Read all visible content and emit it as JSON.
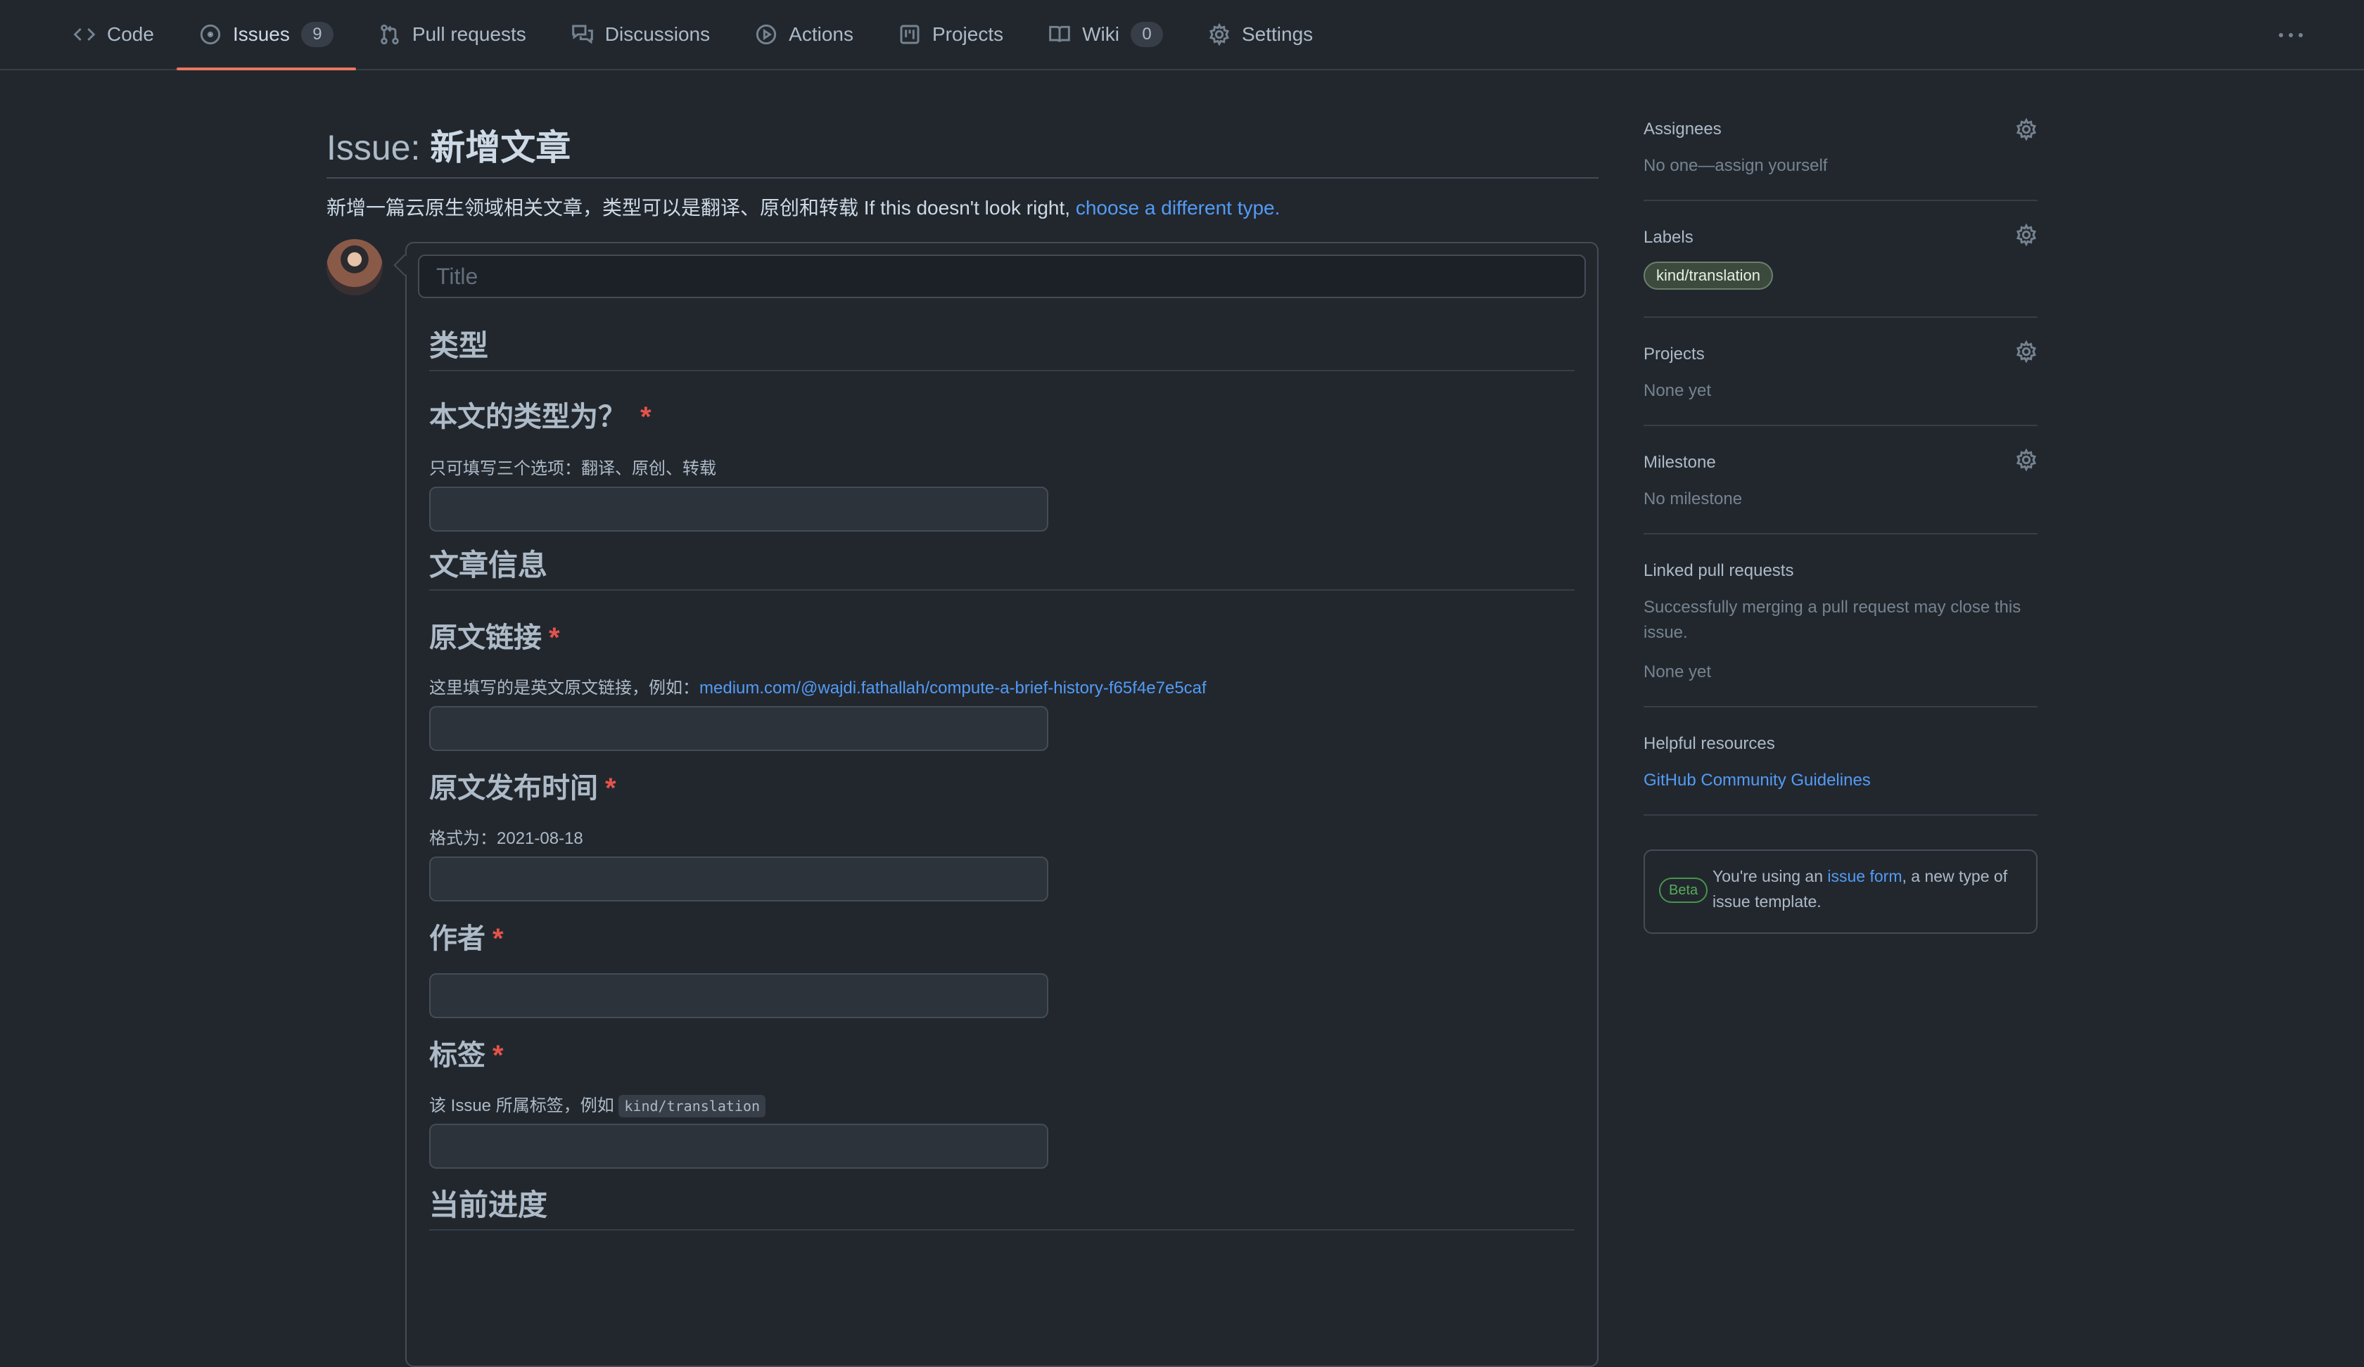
{
  "nav": {
    "tabs": [
      {
        "label": "Code",
        "icon": "code-icon"
      },
      {
        "label": "Issues",
        "icon": "issue-opened-icon",
        "count": "9",
        "active": true
      },
      {
        "label": "Pull requests",
        "icon": "git-pull-request-icon"
      },
      {
        "label": "Discussions",
        "icon": "comment-discussion-icon"
      },
      {
        "label": "Actions",
        "icon": "play-icon"
      },
      {
        "label": "Projects",
        "icon": "project-icon"
      },
      {
        "label": "Wiki",
        "icon": "book-icon",
        "count": "0"
      },
      {
        "label": "Settings",
        "icon": "gear-icon"
      }
    ],
    "more_icon": "kebab-horizontal-icon"
  },
  "issue": {
    "title_prefix": "Issue: ",
    "title_name": "新增文章",
    "description": "新增一篇云原生领域相关文章，类型可以是翻译、原创和转载 If this doesn't look right, ",
    "description_link": "choose a different type.",
    "title_placeholder": "Title"
  },
  "form": {
    "section_type": "类型",
    "type_label": "本文的类型为？",
    "type_desc": "只可填写三个选项：翻译、原创、转载",
    "section_info": "文章信息",
    "link_label": "原文链接",
    "link_desc": "这里填写的是英文原文链接，例如：",
    "link_example": "medium.com/@wajdi.fathallah/compute-a-brief-history-f65f4e7e5caf",
    "date_label": "原文发布时间",
    "date_desc": "格式为：2021-08-18",
    "author_label": "作者",
    "tags_label": "标签",
    "tags_desc": "该 Issue 所属标签，例如 ",
    "tags_code": "kind/translation",
    "section_progress": "当前进度",
    "required_mark": "*"
  },
  "sidebar": {
    "assignees_h": "Assignees",
    "assignees_text": "No one—assign yourself",
    "labels_h": "Labels",
    "label_pill": "kind/translation",
    "projects_h": "Projects",
    "projects_text": "None yet",
    "milestone_h": "Milestone",
    "milestone_text": "No milestone",
    "linked_h": "Linked pull requests",
    "linked_desc_1": "Successfully merging a pull request may close this",
    "linked_desc_2": "issue.",
    "linked_text": "None yet",
    "resources_h": "Helpful resources",
    "resources_link": "GitHub Community Guidelines",
    "beta_pill": "Beta",
    "beta_text_1": "You're using an ",
    "beta_link": "issue form",
    "beta_text_2": ", a new type of issue template."
  },
  "colors": {
    "background": "#22272e",
    "accent_underline": "#ec775c",
    "link": "#539bf5",
    "required": "#e5534b"
  }
}
